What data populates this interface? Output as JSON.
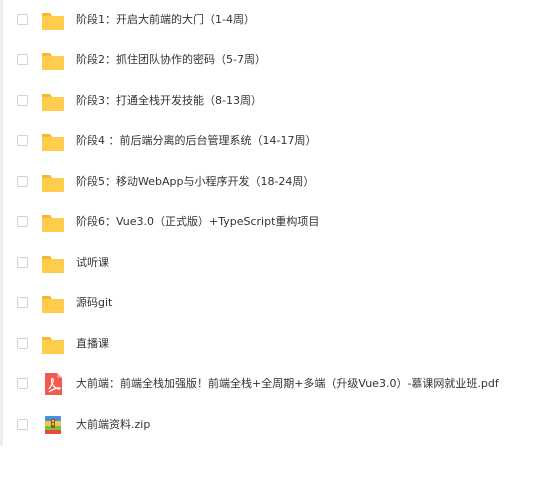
{
  "files": [
    {
      "name": "阶段1：开启大前端的大门（1-4周）",
      "icon": "folder-icon"
    },
    {
      "name": "阶段2：抓住团队协作的密码（5-7周）",
      "icon": "folder-icon"
    },
    {
      "name": "阶段3：打通全栈开发技能（8-13周）",
      "icon": "folder-icon"
    },
    {
      "name": "阶段4 ：前后端分离的后台管理系统（14-17周）",
      "icon": "folder-icon"
    },
    {
      "name": "阶段5：移动WebApp与小程序开发（18-24周）",
      "icon": "folder-icon"
    },
    {
      "name": "阶段6：Vue3.0（正式版）+TypeScript重构项目",
      "icon": "folder-icon"
    },
    {
      "name": "试听课",
      "icon": "folder-icon"
    },
    {
      "name": "源码git",
      "icon": "folder-icon"
    },
    {
      "name": "直播课",
      "icon": "folder-icon"
    },
    {
      "name": "大前端：前端全栈加强版！前端全栈+全周期+多端（升级Vue3.0）-慕课网就业班.pdf",
      "icon": "pdf-icon"
    },
    {
      "name": "大前端资料.zip",
      "icon": "zip-icon"
    }
  ],
  "colors": {
    "folder": "#ffcc4d",
    "folder_tab": "#f5b82e",
    "pdf": "#f05a4f",
    "zip_blue": "#4a90e2",
    "zip_green": "#7ac143",
    "zip_yellow": "#f6c343",
    "zip_red": "#e94c3d",
    "text": "#333333",
    "checkbox_border": "#cfd3d8"
  }
}
